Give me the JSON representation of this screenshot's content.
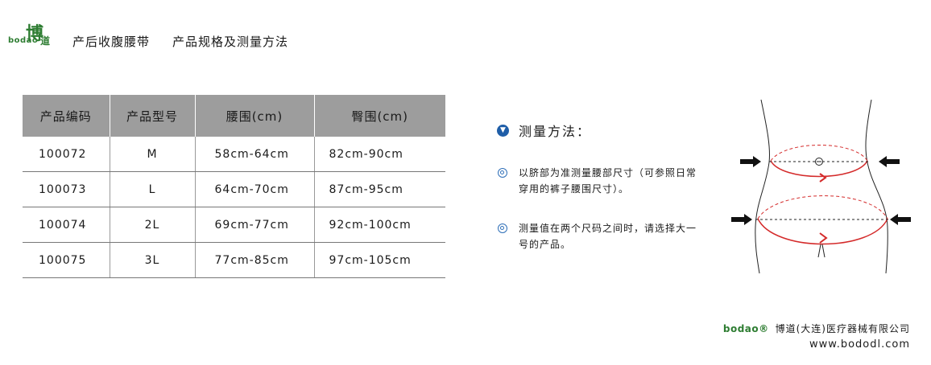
{
  "header": {
    "logo_text": "bodao",
    "logo_glyph": "博",
    "logo_glyph2": "道",
    "title_product": "产后收腹腰带",
    "title_section": "产品规格及测量方法"
  },
  "table": {
    "headers": [
      "产品编码",
      "产品型号",
      "腰围(cm)",
      "臀围(cm)"
    ],
    "rows": [
      [
        "100072",
        "M",
        "58cm-64cm",
        "82cm-90cm"
      ],
      [
        "100073",
        "L",
        "64cm-70cm",
        "87cm-95cm"
      ],
      [
        "100074",
        "2L",
        "69cm-77cm",
        "92cm-100cm"
      ],
      [
        "100075",
        "3L",
        "77cm-85cm",
        "97cm-105cm"
      ]
    ]
  },
  "method": {
    "icon": "chevron-down-icon",
    "title": "测量方法：",
    "notes": [
      "以脐部为准测量腰部尺寸（可参照日常穿用的裤子腰围尺寸）。",
      "测量值在两个尺码之间时，请选择大一号的产品。"
    ]
  },
  "colors": {
    "brand_green": "#2e7d32",
    "header_gray": "#9d9d9d",
    "accent_blue": "#1f5ea8",
    "measure_red": "#d42a2a"
  },
  "footer": {
    "logo_text": "bodao®",
    "company": "博道(大连)医疗器械有限公司",
    "url": "www.bododl.com"
  }
}
